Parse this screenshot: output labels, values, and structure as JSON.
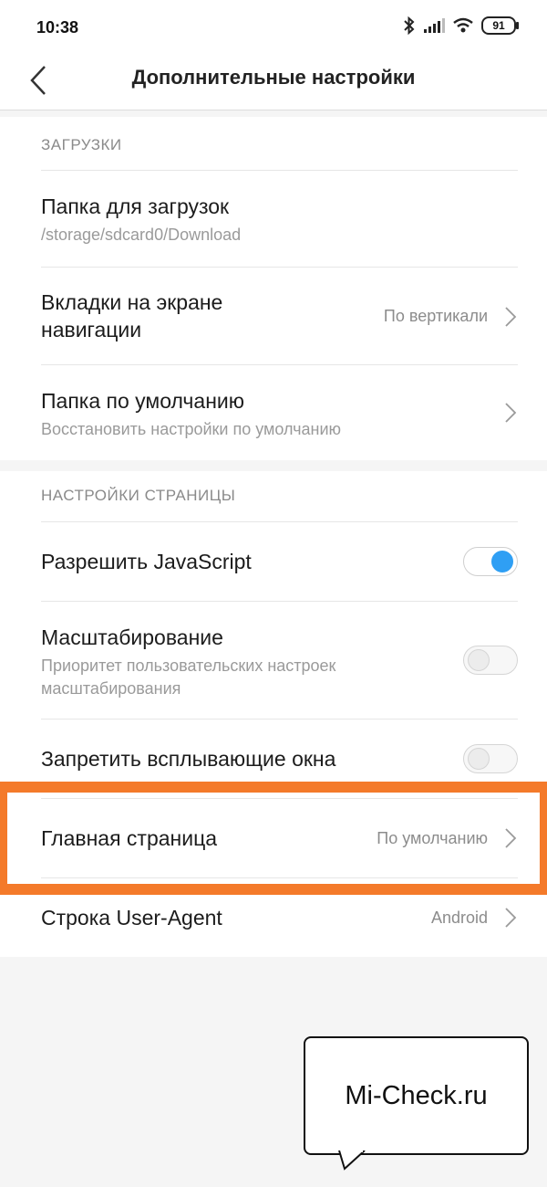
{
  "status": {
    "time": "10:38",
    "battery": "91",
    "icons": [
      "bluetooth-icon",
      "signal-icon",
      "wifi-icon",
      "battery-icon"
    ]
  },
  "header": {
    "title": "Дополнительные настройки",
    "back_icon": "chevron-left-icon"
  },
  "downloads": {
    "heading": "ЗАГРУЗКИ",
    "folder": {
      "title": "Папка для загрузок",
      "subtitle": "/storage/sdcard0/Download"
    },
    "tabs": {
      "title_line1": "Вкладки на экране",
      "title_line2": "навигации",
      "value": "По вертикали"
    },
    "default_folder": {
      "title": "Папка по умолчанию",
      "subtitle": "Восстановить настройки по умолчанию"
    }
  },
  "page_settings": {
    "heading": "НАСТРОЙКИ СТРАНИЦЫ",
    "javascript": {
      "title": "Разрешить JavaScript",
      "enabled": true
    },
    "scaling": {
      "title": "Масштабирование",
      "subtitle_line1": "Приоритет пользовательских настроек",
      "subtitle_line2": "масштабирования",
      "enabled": false
    },
    "popups": {
      "title": "Запретить всплывающие окна",
      "enabled": false
    },
    "homepage": {
      "title": "Главная страница",
      "value": "По умолчанию"
    },
    "user_agent": {
      "title": "Строка User-Agent",
      "value": "Android"
    }
  },
  "watermark": {
    "text": "Mi-Check.ru"
  },
  "colors": {
    "accent": "#2f9ff4",
    "highlight": "#f47a2a",
    "background": "#f5f5f5"
  }
}
